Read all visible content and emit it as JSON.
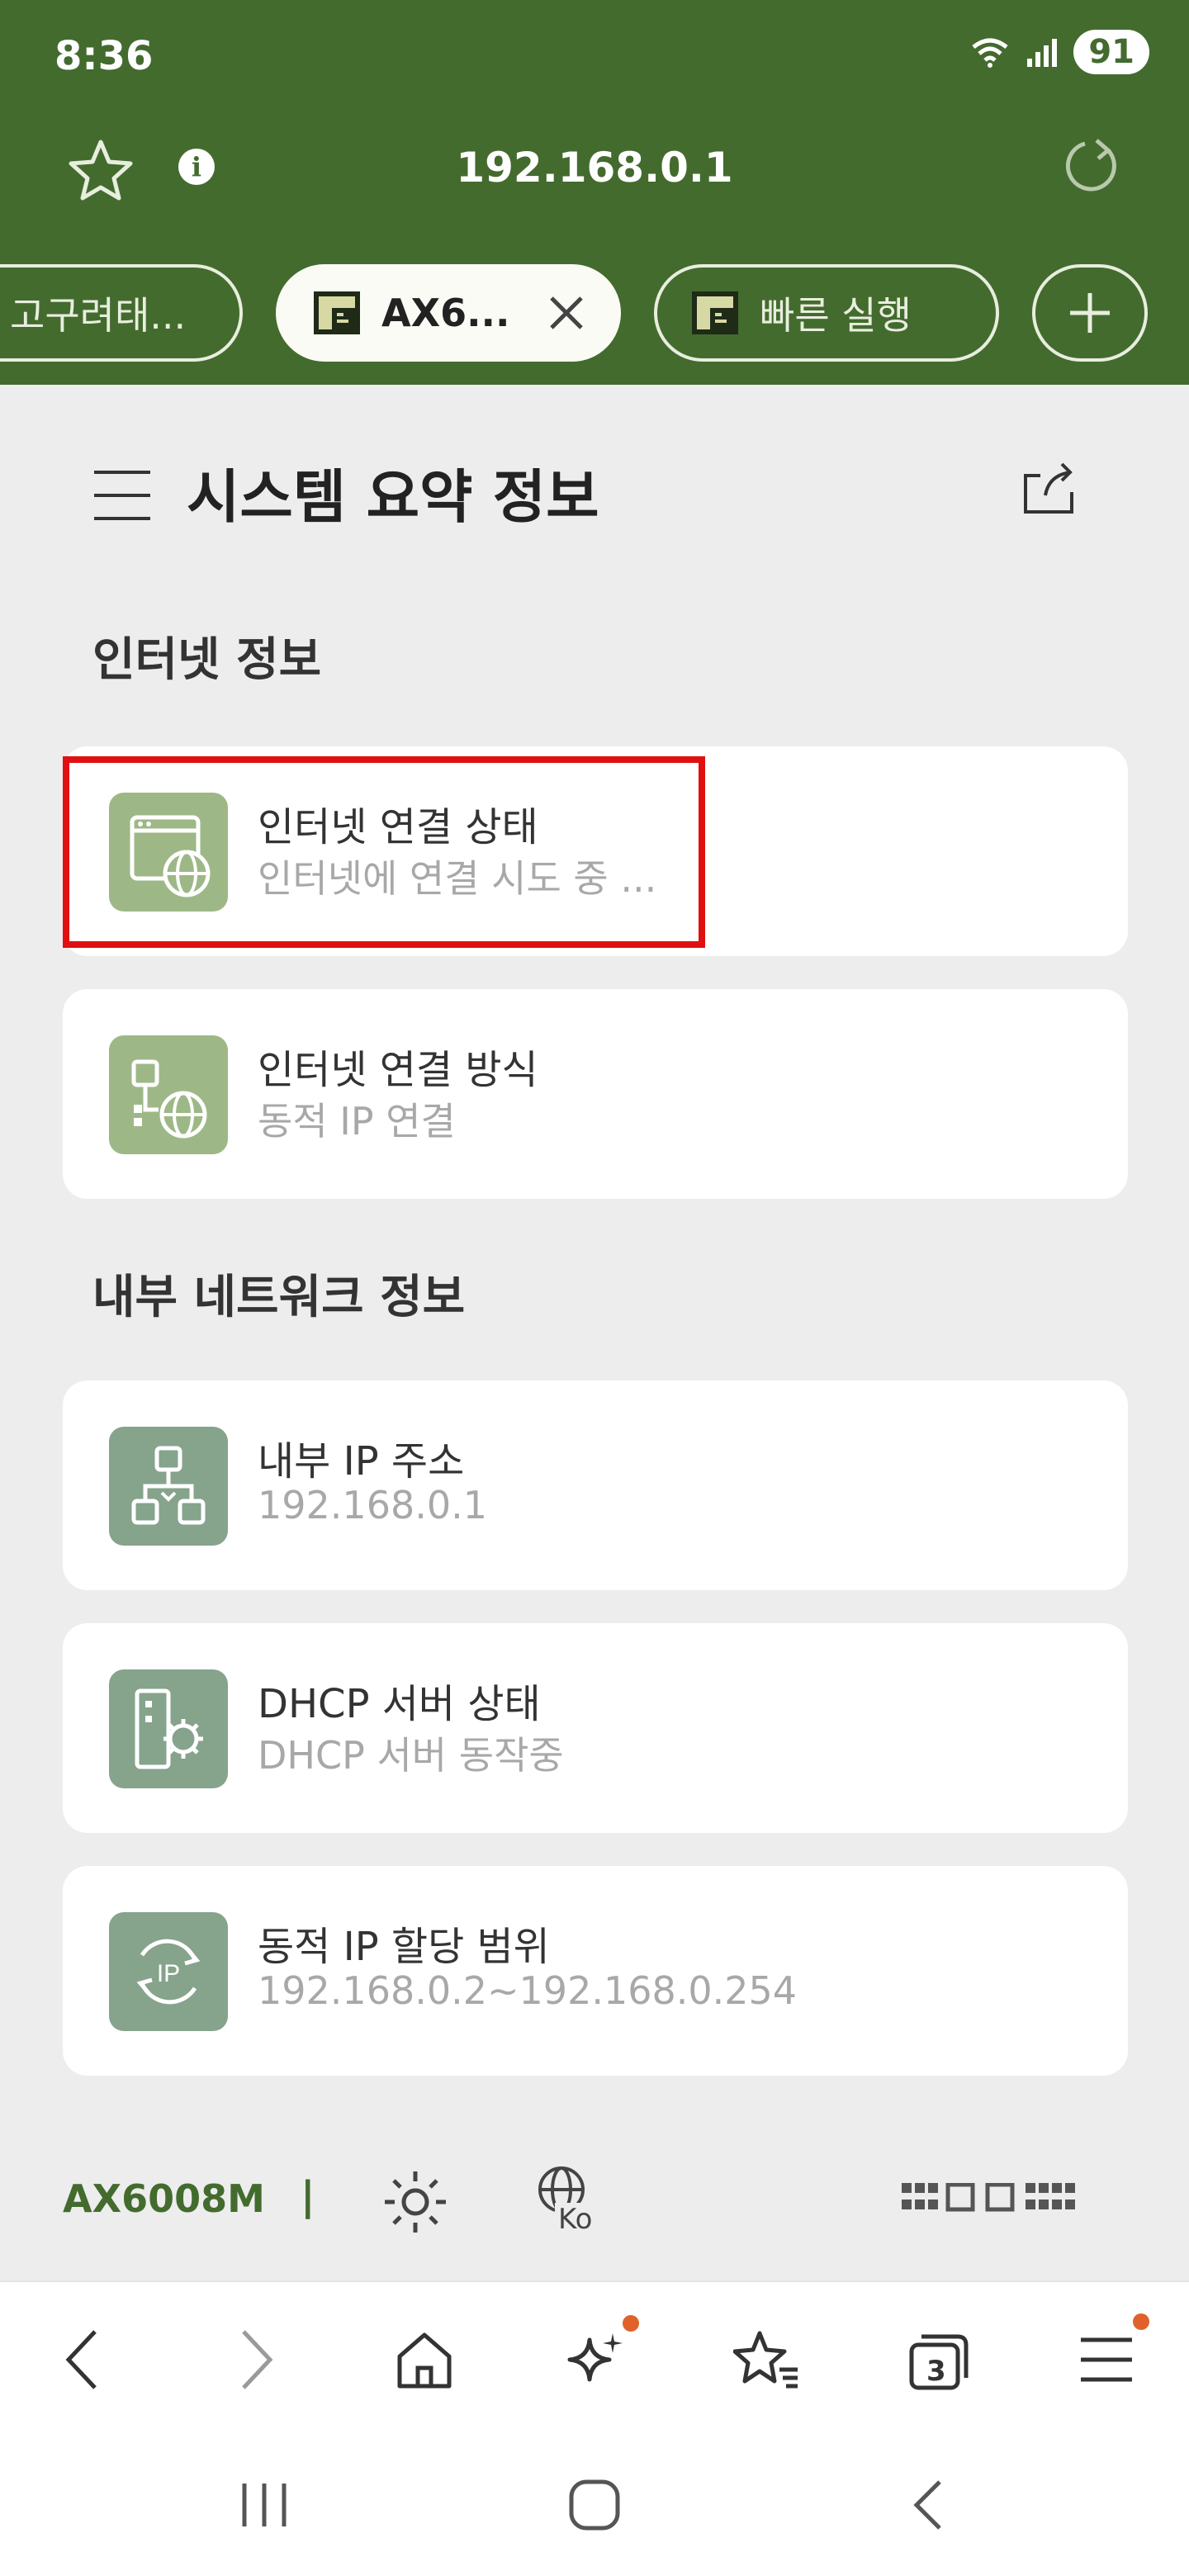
{
  "status": {
    "time": "8:36",
    "battery": "91"
  },
  "urlbar": {
    "url": "192.168.0.1"
  },
  "tabs": [
    {
      "label": "고구려태..."
    },
    {
      "label": "AX6..."
    },
    {
      "label": "빠른 실행"
    }
  ],
  "page": {
    "title": "시스템 요약 정보"
  },
  "sections": {
    "internet": {
      "title": "인터넷 정보"
    },
    "lan": {
      "title": "내부 네트워크 정보"
    }
  },
  "cards": {
    "connection_status": {
      "title": "인터넷 연결 상태",
      "value": "인터넷에 연결 시도 중 ..."
    },
    "connection_type": {
      "title": "인터넷 연결 방식",
      "value": "동적 IP 연결"
    },
    "internal_ip": {
      "title": "내부 IP 주소",
      "value": "192.168.0.1"
    },
    "dhcp_status": {
      "title": "DHCP 서버 상태",
      "value": "DHCP 서버 동작중"
    },
    "dhcp_range": {
      "title": "동적 IP 할당 범위",
      "value": "192.168.0.2~192.168.0.254"
    }
  },
  "footer": {
    "model": "AX6008M",
    "separator": "|",
    "language_code": "Ko"
  },
  "browser_nav": {
    "tab_count": "3"
  },
  "colors": {
    "brand_green": "#436b2e",
    "highlight_red": "#e01010",
    "badge_orange": "#e0622a"
  },
  "icons": [
    "star-icon",
    "info-icon",
    "reload-icon",
    "close-icon",
    "plus-icon",
    "menu-icon",
    "share-icon",
    "browser-globe-icon",
    "network-globe-icon",
    "hierarchy-icon",
    "server-gear-icon",
    "ip-cycle-icon",
    "gear-icon",
    "language-globe-icon",
    "layout-icon",
    "back-icon",
    "forward-icon",
    "home-icon",
    "sparkle-icon",
    "bookmarks-icon",
    "tabs-icon",
    "hamburger-icon",
    "recents-icon",
    "home-circle-icon"
  ]
}
